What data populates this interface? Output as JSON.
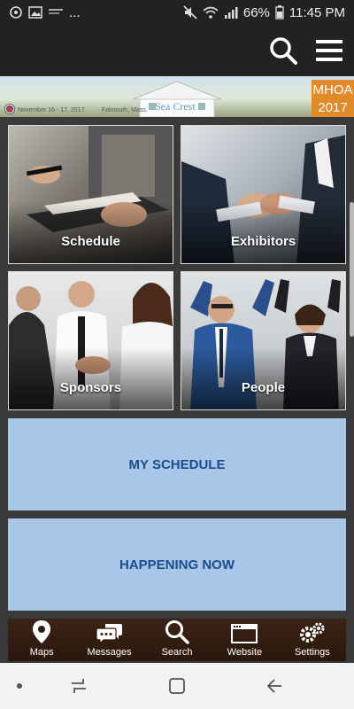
{
  "status": {
    "battery": "66%",
    "time": "11:45 PM",
    "notification_text": "..."
  },
  "banner": {
    "dates": "November 16 - 17, 2017",
    "location": "Falmouth, Mass.",
    "logo_text": "Sea Crest",
    "event_name": "MHOA",
    "event_year": "2017"
  },
  "tiles": [
    {
      "label": "Schedule"
    },
    {
      "label": "Exhibitors"
    },
    {
      "label": "Sponsors"
    },
    {
      "label": "People"
    }
  ],
  "panels": [
    {
      "label": "MY SCHEDULE"
    },
    {
      "label": "HAPPENING NOW"
    }
  ],
  "tabs": [
    {
      "label": "Maps",
      "icon": "map-pin-icon"
    },
    {
      "label": "Messages",
      "icon": "chat-bubbles-icon"
    },
    {
      "label": "Search",
      "icon": "search-icon"
    },
    {
      "label": "Website",
      "icon": "browser-window-icon"
    },
    {
      "label": "Settings",
      "icon": "gears-icon"
    }
  ],
  "colors": {
    "panel_bg": "#a8c6e8",
    "panel_text": "#1b4c8c",
    "tabbar_bg": "#3b2415",
    "banner_accent": "#e08a2a"
  }
}
